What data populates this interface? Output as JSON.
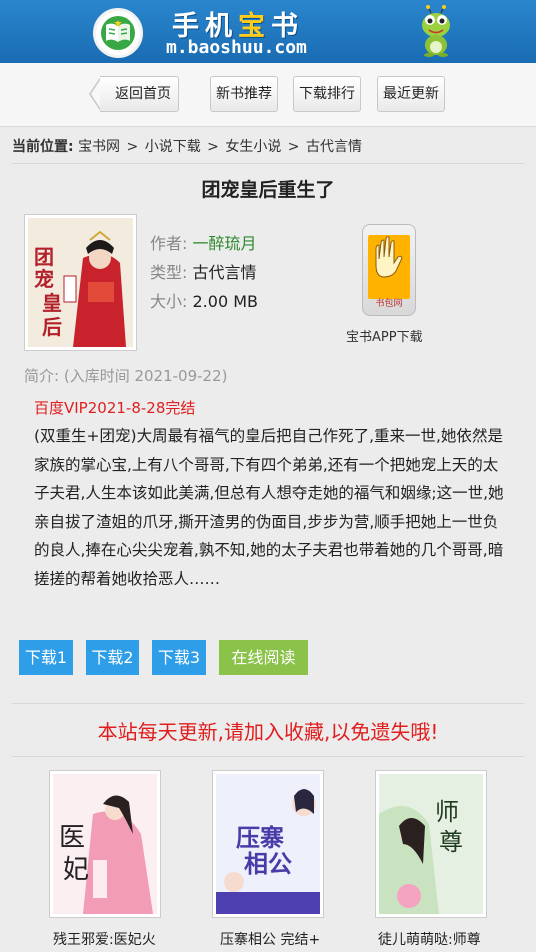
{
  "header": {
    "site_name_a": "手机",
    "site_name_b": "宝",
    "site_name_c": "书",
    "site_url": "m.baoshuu.com"
  },
  "nav": {
    "back": "返回首页",
    "new_books": "新书推荐",
    "download_rank": "下载排行",
    "recent_update": "最近更新"
  },
  "breadcrumb": {
    "label": "当前位置:",
    "items": [
      "宝书网",
      "小说下载",
      "女生小说",
      "古代言情"
    ],
    "sep": ">"
  },
  "book": {
    "title": "团宠皇后重生了",
    "author_key": "作者:",
    "author": "一醉琉月",
    "type_key": "类型:",
    "type": "古代言情",
    "size_key": "大小:",
    "size": "2.00 MB",
    "cover_text": "团宠皇后",
    "intro_label": "简介:",
    "added_time": "(入库时间 2021-09-22)",
    "vip_note": "百度VIP2021-8-28完结",
    "description": "(双重生+团宠)大周最有福气的皇后把自己作死了,重来一世,她依然是家族的掌心宝,上有八个哥哥,下有四个弟弟,还有一个把她宠上天的太子夫君,人生本该如此美满,但总有人想夺走她的福气和姻缘;这一世,她亲自拔了渣姐的爪牙,撕开渣男的伪面目,步步为营,顺手把她上一世负的良人,捧在心尖尖宠着,孰不知,她的太子夫君也带着她的几个哥哥,暗搓搓的帮着她收拾恶人……"
  },
  "app": {
    "phone_label": "书包网",
    "download_label": "宝书APP下载"
  },
  "buttons": {
    "dl1": "下载1",
    "dl2": "下载2",
    "dl3": "下载3",
    "read_online": "在线阅读"
  },
  "notice": "本站每天更新,请加入收藏,以免遗失哦!",
  "recommendations": [
    {
      "title": "残王邪爱:医妃火",
      "cover_text": "医妃"
    },
    {
      "title": "压寨相公 完结+",
      "cover_text": "压寨相公"
    },
    {
      "title": "徒儿萌萌哒:师尊",
      "cover_text": "师尊"
    }
  ],
  "colors": {
    "header_blue": "#1a6cb3",
    "author_green": "#2f8a2f",
    "red": "#e01e1e",
    "download_blue": "#2e9ee8",
    "read_green": "#8bc34a"
  }
}
